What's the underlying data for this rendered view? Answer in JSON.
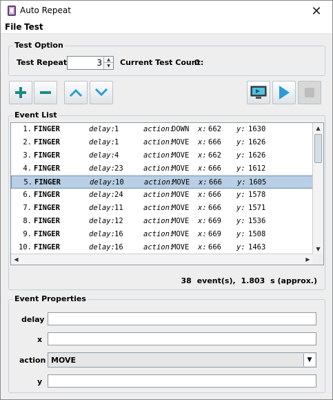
{
  "window": {
    "title": "Auto Repeat",
    "close_glyph": "✕"
  },
  "menu": [
    {
      "label": "File"
    },
    {
      "label": "Test"
    }
  ],
  "test_option": {
    "legend": "Test Option",
    "repeat_label": "Test Repeat:",
    "repeat_value": "3",
    "count_label": "Current Test Count:",
    "count_value": "0"
  },
  "toolbar": {
    "buttons": [
      "add-icon",
      "remove-icon",
      "move-up-icon",
      "move-down-icon",
      "screen-capture-icon",
      "play-icon",
      "stop-icon"
    ],
    "accent": "#2a9bd8"
  },
  "event_list": {
    "legend": "Event List",
    "selected_index": 4,
    "keys": {
      "delay": "delay:",
      "action": "action:",
      "x": "x:",
      "y": "y:"
    },
    "rows": [
      {
        "index": "1.",
        "type": "FINGER",
        "delay": "1",
        "action": "DOWN",
        "x": "662",
        "y": "1630"
      },
      {
        "index": "2.",
        "type": "FINGER",
        "delay": "1",
        "action": "MOVE",
        "x": "666",
        "y": "1626"
      },
      {
        "index": "3.",
        "type": "FINGER",
        "delay": "4",
        "action": "MOVE",
        "x": "662",
        "y": "1626"
      },
      {
        "index": "4.",
        "type": "FINGER",
        "delay": "23",
        "action": "MOVE",
        "x": "666",
        "y": "1612"
      },
      {
        "index": "5.",
        "type": "FINGER",
        "delay": "10",
        "action": "MOVE",
        "x": "666",
        "y": "1605"
      },
      {
        "index": "6.",
        "type": "FINGER",
        "delay": "24",
        "action": "MOVE",
        "x": "666",
        "y": "1578"
      },
      {
        "index": "7.",
        "type": "FINGER",
        "delay": "11",
        "action": "MOVE",
        "x": "666",
        "y": "1571"
      },
      {
        "index": "8.",
        "type": "FINGER",
        "delay": "12",
        "action": "MOVE",
        "x": "669",
        "y": "1536"
      },
      {
        "index": "9.",
        "type": "FINGER",
        "delay": "16",
        "action": "MOVE",
        "x": "669",
        "y": "1508"
      },
      {
        "index": "10.",
        "type": "FINGER",
        "delay": "16",
        "action": "MOVE",
        "x": "666",
        "y": "1463"
      }
    ],
    "summary": {
      "count": "38",
      "count_unit": "event(s),",
      "duration": "1.803",
      "duration_unit": "s (approx.)"
    }
  },
  "event_properties": {
    "legend": "Event Properties",
    "delay_label": "delay",
    "delay_value": "",
    "x_label": "x",
    "x_value": "",
    "action_label": "action",
    "action_value": "MOVE",
    "y_label": "y",
    "y_value": ""
  }
}
